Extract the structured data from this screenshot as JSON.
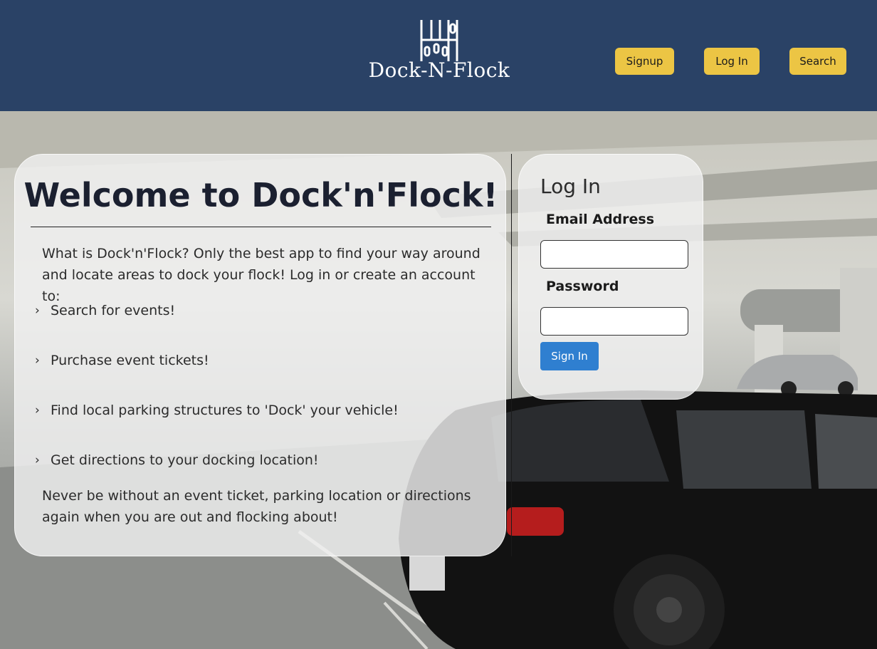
{
  "header": {
    "logo_text": "Dock-N-Flock",
    "nav": [
      {
        "label": "Signup"
      },
      {
        "label": "Log In"
      },
      {
        "label": "Search"
      }
    ]
  },
  "welcome": {
    "title": "Welcome to Dock'n'Flock!",
    "intro": "What is Dock'n'Flock? Only the best app to find your way around and locate areas to dock your flock! Log in or create an account to:",
    "features": [
      "Search for events!",
      "Purchase event tickets!",
      "Find local parking structures to 'Dock' your vehicle!",
      "Get directions to your docking location!"
    ],
    "outro": "Never be without an event ticket, parking location or directions again when you are out and flocking about!"
  },
  "login": {
    "title": "Log In",
    "email_label": "Email Address",
    "password_label": "Password",
    "submit_label": "Sign In"
  },
  "colors": {
    "header_bg": "#2a4266",
    "nav_button": "#ecc544",
    "signin_button": "#2f7fd0"
  }
}
